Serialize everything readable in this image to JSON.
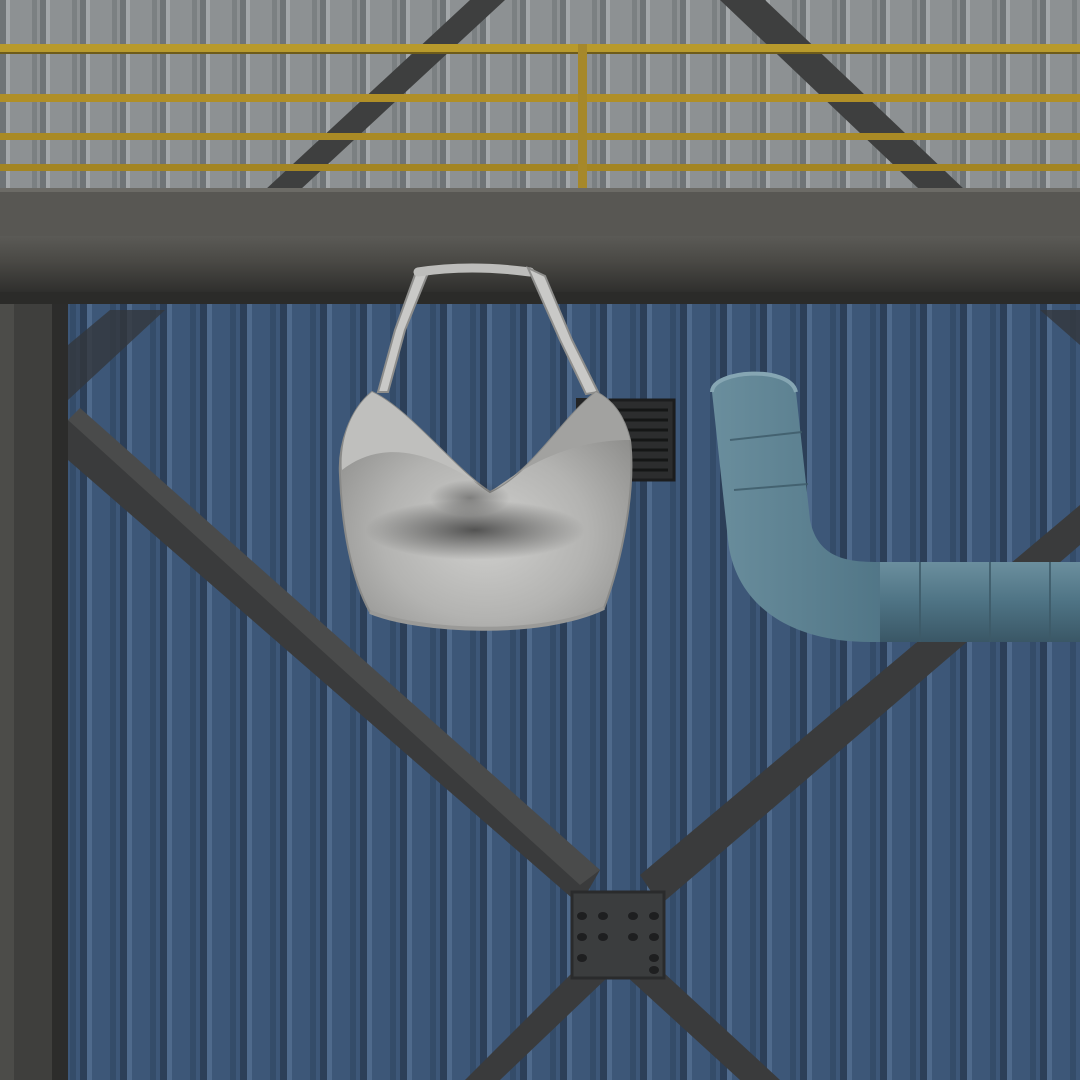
{
  "scene": {
    "subject": "grey-halter-crop-top",
    "background": "industrial-warehouse-wall",
    "colors": {
      "upper_wall": "#8f9395",
      "lower_wall": "#3c5677",
      "beam": "#3a3a38",
      "railing": "#b89a2c",
      "pipe": "#4f7486",
      "garment": "#b8b8b6"
    },
    "icons": [
      "wall-vent-icon",
      "steel-plate-icon"
    ]
  }
}
